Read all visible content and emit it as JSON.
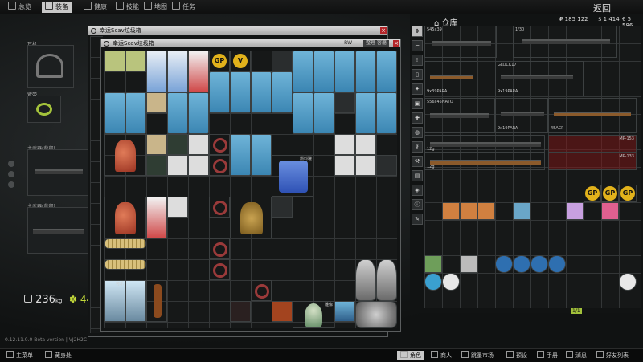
{
  "top_nav": {
    "tabs": [
      {
        "label": "总览",
        "icon": "overview-icon"
      },
      {
        "label": "装备",
        "icon": "gear-equipment-icon",
        "active": true
      },
      {
        "label": "健康",
        "icon": "health-icon"
      },
      {
        "label": "技能",
        "icon": "skills-icon"
      },
      {
        "label": "地图",
        "icon": "map-icon"
      },
      {
        "label": "任务",
        "icon": "tasks-icon"
      }
    ],
    "back_label": "返回"
  },
  "equipment": {
    "earpiece_label": "耳机",
    "armband_label": "臂带",
    "primary_label": "主武器(背部)",
    "secondary_label": "主武器(背部)",
    "weight": "236",
    "weight_unit": "kg",
    "weight_small": "44"
  },
  "outer_window": {
    "title": "幸运Scav垃圾箱",
    "tag": "RW",
    "sort_label": "整理 容器",
    "close": "×"
  },
  "inner_window": {
    "title": "幸运Scav垃圾箱",
    "sort_label": "整理 容器",
    "close": "×"
  },
  "stash": {
    "title": "仓库",
    "rub": "₽ 185 122",
    "usd": "$ 1 414",
    "eur": "€ 5 586",
    "weapons": [
      {
        "name": "545x39",
        "sub": "AK-74N"
      },
      {
        "name": "9x18PM",
        "sub": "1/30"
      },
      {
        "name": "9x39PARA",
        "sub": "9x39PARA"
      },
      {
        "name": "9x19PARA",
        "sub": "GLOCK17"
      },
      {
        "name": "556x45NATO",
        "sub": "M4A1"
      },
      {
        "name": "9x19PARA",
        "sub": "MPX"
      },
      {
        "name": "45ACP",
        "sub": "UMP"
      },
      {
        "name": "12g",
        "sub": "MP-153"
      },
      {
        "name": "12g",
        "sub": "MP-133"
      }
    ],
    "footer_counts": "1/1"
  },
  "footer_left": "0.12.11.0.0  Beta version | VJ2H2C",
  "bottom_bar": {
    "left": [
      {
        "label": "主菜单",
        "icon": "menu-icon"
      },
      {
        "label": "藏身处",
        "icon": "hideout-icon"
      }
    ],
    "right": [
      {
        "label": "角色",
        "icon": "character-icon",
        "active": true
      },
      {
        "label": "商人",
        "icon": "traders-icon"
      },
      {
        "label": "跳蚤市场",
        "icon": "flea-market-icon"
      },
      {
        "label": "预设",
        "icon": "presets-icon"
      },
      {
        "label": "手册",
        "icon": "handbook-icon"
      },
      {
        "label": "消息",
        "icon": "messages-icon"
      },
      {
        "label": "好友列表",
        "icon": "friends-icon"
      }
    ]
  },
  "item_labels": {
    "fuel": "燃料罐",
    "cola": "可乐",
    "statue": "雕像",
    "tube": "1/20"
  }
}
